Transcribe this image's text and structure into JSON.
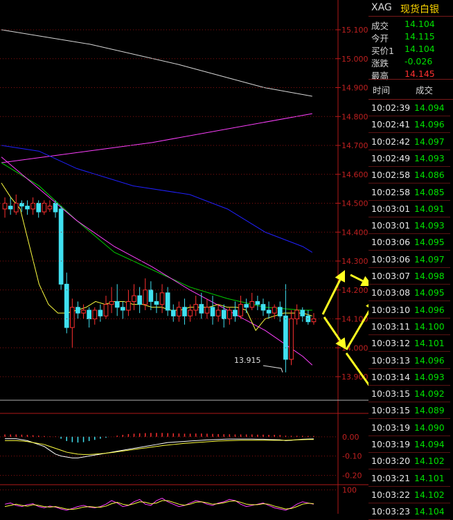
{
  "header": {
    "symbol": "XAG",
    "name": "现货白银"
  },
  "quote": [
    {
      "label": "成交",
      "value": "14.104",
      "color": "#00e000"
    },
    {
      "label": "今开",
      "value": "14.115",
      "color": "#00e000"
    },
    {
      "label": "买价1",
      "value": "14.104",
      "color": "#00e000"
    },
    {
      "label": "涨跌",
      "value": "-0.026",
      "color": "#00e000"
    },
    {
      "label": "最高",
      "value": "14.145",
      "color": "#ff3030"
    }
  ],
  "ticks_header": {
    "time": "时间",
    "price": "成交"
  },
  "ticks": [
    {
      "time": "10:02:39",
      "price": "14.094"
    },
    {
      "time": "10:02:41",
      "price": "14.096"
    },
    {
      "time": "10:02:42",
      "price": "14.097"
    },
    {
      "time": "10:02:49",
      "price": "14.093"
    },
    {
      "time": "10:02:58",
      "price": "14.086"
    },
    {
      "time": "10:02:58",
      "price": "14.085"
    },
    {
      "time": "10:03:01",
      "price": "14.091"
    },
    {
      "time": "10:03:01",
      "price": "14.093"
    },
    {
      "time": "10:03:06",
      "price": "14.095"
    },
    {
      "time": "10:03:06",
      "price": "14.097"
    },
    {
      "time": "10:03:07",
      "price": "14.098"
    },
    {
      "time": "10:03:08",
      "price": "14.095"
    },
    {
      "time": "10:03:10",
      "price": "14.096"
    },
    {
      "time": "10:03:11",
      "price": "14.100"
    },
    {
      "time": "10:03:12",
      "price": "14.101"
    },
    {
      "time": "10:03:13",
      "price": "14.096"
    },
    {
      "time": "10:03:14",
      "price": "14.093"
    },
    {
      "time": "10:03:15",
      "price": "14.092"
    },
    {
      "time": "10:03:15",
      "price": "14.089"
    },
    {
      "time": "10:03:19",
      "price": "14.090"
    },
    {
      "time": "10:03:19",
      "price": "14.094"
    },
    {
      "time": "10:03:20",
      "price": "14.102"
    },
    {
      "time": "10:03:21",
      "price": "14.101"
    },
    {
      "time": "10:03:22",
      "price": "14.102"
    },
    {
      "time": "10:03:23",
      "price": "14.104"
    }
  ],
  "chart_data": {
    "type": "candlestick",
    "main": {
      "y_ticks": [
        "15.100",
        "15.000",
        "14.900",
        "14.800",
        "14.700",
        "14.600",
        "14.500",
        "14.400",
        "14.300",
        "14.200",
        "14.100",
        "14.000",
        "13.900"
      ],
      "ylim": [
        13.85,
        15.12
      ],
      "low_annotation": {
        "label": "13.915",
        "value": 13.915
      },
      "candles": [
        [
          14.48,
          14.5,
          14.45,
          14.52
        ],
        [
          14.49,
          14.48,
          14.46,
          14.52
        ],
        [
          14.47,
          14.5,
          14.46,
          14.53
        ],
        [
          14.5,
          14.49,
          14.47,
          14.51
        ],
        [
          14.49,
          14.48,
          14.46,
          14.51
        ],
        [
          14.48,
          14.5,
          14.46,
          14.52
        ],
        [
          14.5,
          14.47,
          14.45,
          14.51
        ],
        [
          14.47,
          14.5,
          14.46,
          14.51
        ],
        [
          14.48,
          14.49,
          14.47,
          14.51
        ],
        [
          14.5,
          14.47,
          14.45,
          14.51
        ],
        [
          14.48,
          14.22,
          14.2,
          14.49
        ],
        [
          14.22,
          14.07,
          14.05,
          14.26
        ],
        [
          14.07,
          14.14,
          14.0,
          14.17
        ],
        [
          14.14,
          14.12,
          14.1,
          14.16
        ],
        [
          14.12,
          14.13,
          14.1,
          14.15
        ],
        [
          14.13,
          14.1,
          14.07,
          14.14
        ],
        [
          14.1,
          14.13,
          14.08,
          14.14
        ],
        [
          14.13,
          14.11,
          14.09,
          14.15
        ],
        [
          14.11,
          14.15,
          14.1,
          14.18
        ],
        [
          14.15,
          14.16,
          14.12,
          14.21
        ],
        [
          14.16,
          14.14,
          14.11,
          14.22
        ],
        [
          14.14,
          14.13,
          14.1,
          14.16
        ],
        [
          14.13,
          14.16,
          14.11,
          14.2
        ],
        [
          14.16,
          14.18,
          14.13,
          14.22
        ],
        [
          14.18,
          14.15,
          14.12,
          14.21
        ],
        [
          14.15,
          14.2,
          14.13,
          14.24
        ],
        [
          14.2,
          14.16,
          14.13,
          14.23
        ],
        [
          14.16,
          14.15,
          14.12,
          14.19
        ],
        [
          14.15,
          14.19,
          14.12,
          14.22
        ],
        [
          14.19,
          14.13,
          14.11,
          14.21
        ],
        [
          14.13,
          14.11,
          14.09,
          14.15
        ],
        [
          14.11,
          14.14,
          14.09,
          14.16
        ],
        [
          14.14,
          14.11,
          14.08,
          14.17
        ],
        [
          14.11,
          14.13,
          14.09,
          14.15
        ],
        [
          14.13,
          14.15,
          14.11,
          14.18
        ],
        [
          14.15,
          14.12,
          14.1,
          14.19
        ],
        [
          14.12,
          14.14,
          14.1,
          14.17
        ],
        [
          14.14,
          14.11,
          14.08,
          14.18
        ],
        [
          14.11,
          14.13,
          14.09,
          14.15
        ],
        [
          14.13,
          14.1,
          14.07,
          14.15
        ],
        [
          14.1,
          14.13,
          14.08,
          14.14
        ],
        [
          14.13,
          14.11,
          14.09,
          14.16
        ],
        [
          14.11,
          14.15,
          14.1,
          14.18
        ],
        [
          14.15,
          14.14,
          14.12,
          14.17
        ],
        [
          14.14,
          14.16,
          14.13,
          14.19
        ],
        [
          14.16,
          14.15,
          14.13,
          14.18
        ],
        [
          14.15,
          14.13,
          14.11,
          14.17
        ],
        [
          14.13,
          14.12,
          14.1,
          14.16
        ],
        [
          14.12,
          14.14,
          14.1,
          14.15
        ],
        [
          14.14,
          14.11,
          14.09,
          14.16
        ],
        [
          14.11,
          13.96,
          13.915,
          14.22
        ],
        [
          13.96,
          14.1,
          13.94,
          14.13
        ],
        [
          14.1,
          14.13,
          14.08,
          14.15
        ],
        [
          14.13,
          14.11,
          14.09,
          14.14
        ],
        [
          14.11,
          14.09,
          14.08,
          14.13
        ],
        [
          14.09,
          14.1,
          14.08,
          14.12
        ]
      ],
      "ma_lines": [
        {
          "color": "#d8d8d8",
          "points": [
            [
              0,
              15.1
            ],
            [
              94,
              15.05
            ],
            [
              188,
              14.98
            ],
            [
              279,
              14.9
            ],
            [
              330,
              14.87
            ]
          ]
        },
        {
          "color": "#ff40ff",
          "points": [
            [
              0,
              14.64
            ],
            [
              160,
              14.71
            ],
            [
              330,
              14.81
            ]
          ]
        },
        {
          "color": "#2020ff",
          "points": [
            [
              0,
              14.7
            ],
            [
              40,
              14.68
            ],
            [
              80,
              14.62
            ],
            [
              140,
              14.56
            ],
            [
              200,
              14.53
            ],
            [
              240,
              14.48
            ],
            [
              280,
              14.4
            ],
            [
              320,
              14.35
            ],
            [
              330,
              14.33
            ]
          ]
        },
        {
          "color": "#00d000",
          "points": [
            [
              0,
              14.64
            ],
            [
              40,
              14.56
            ],
            [
              80,
              14.44
            ],
            [
              120,
              14.33
            ],
            [
              160,
              14.27
            ],
            [
              200,
              14.21
            ],
            [
              240,
              14.17
            ],
            [
              280,
              14.14
            ],
            [
              320,
              14.13
            ],
            [
              330,
              14.13
            ]
          ]
        },
        {
          "color": "#ff40ff",
          "points": [
            [
              0,
              14.66
            ],
            [
              40,
              14.55
            ],
            [
              80,
              14.44
            ],
            [
              120,
              14.35
            ],
            [
              160,
              14.28
            ],
            [
              200,
              14.2
            ],
            [
              240,
              14.13
            ],
            [
              280,
              14.06
            ],
            [
              320,
              13.97
            ],
            [
              330,
              13.94
            ]
          ]
        },
        {
          "color": "#ffff40",
          "points": [
            [
              0,
              14.57
            ],
            [
              10,
              14.52
            ],
            [
              20,
              14.48
            ],
            [
              30,
              14.35
            ],
            [
              40,
              14.22
            ],
            [
              50,
              14.15
            ],
            [
              60,
              14.12
            ],
            [
              70,
              14.12
            ],
            [
              80,
              14.13
            ],
            [
              90,
              14.14
            ],
            [
              100,
              14.16
            ],
            [
              110,
              14.15
            ],
            [
              120,
              14.16
            ],
            [
              130,
              14.16
            ],
            [
              140,
              14.15
            ],
            [
              150,
              14.15
            ],
            [
              160,
              14.14
            ],
            [
              170,
              14.14
            ],
            [
              180,
              14.13
            ],
            [
              190,
              14.13
            ],
            [
              200,
              14.14
            ],
            [
              210,
              14.14
            ],
            [
              220,
              14.14
            ],
            [
              230,
              14.15
            ],
            [
              240,
              14.14
            ],
            [
              250,
              14.14
            ],
            [
              260,
              14.13
            ],
            [
              270,
              14.06
            ],
            [
              280,
              14.1
            ],
            [
              290,
              14.11
            ],
            [
              300,
              14.12
            ],
            [
              310,
              14.12
            ],
            [
              320,
              14.12
            ],
            [
              330,
              14.11
            ]
          ]
        }
      ]
    },
    "macd": {
      "y_ticks": [
        "0.00",
        "-0.10",
        "-0.20"
      ],
      "ylim": [
        -0.22,
        0.1
      ],
      "hist": [
        0.012,
        0.012,
        0.012,
        0.011,
        0.01,
        0.008,
        0.006,
        0.004,
        0.002,
        0.002,
        -0.01,
        -0.022,
        -0.028,
        -0.03,
        -0.028,
        -0.022,
        -0.016,
        -0.01,
        -0.005,
        0.0,
        0.006,
        0.01,
        0.014,
        0.016,
        0.018,
        0.019,
        0.02,
        0.02,
        0.02,
        0.019,
        0.018,
        0.017,
        0.016,
        0.016,
        0.017,
        0.017,
        0.016,
        0.015,
        0.014,
        0.013,
        0.013,
        0.012,
        0.012,
        0.012,
        0.012,
        0.011,
        0.011,
        0.01,
        0.01,
        0.009,
        0.006,
        0.005,
        0.005,
        0.005,
        0.004,
        0.004
      ],
      "lines": [
        {
          "color": "#ffffff",
          "values": [
            -0.01,
            -0.01,
            -0.01,
            -0.015,
            -0.02,
            -0.03,
            -0.04,
            -0.05,
            -0.07,
            -0.09,
            -0.1,
            -0.105,
            -0.11,
            -0.11,
            -0.105,
            -0.1,
            -0.095,
            -0.09,
            -0.085,
            -0.08,
            -0.075,
            -0.07,
            -0.065,
            -0.06,
            -0.055,
            -0.05,
            -0.045,
            -0.04,
            -0.035,
            -0.03,
            -0.028,
            -0.026,
            -0.024,
            -0.022,
            -0.02,
            -0.018,
            -0.016,
            -0.015,
            -0.014,
            -0.013,
            -0.012,
            -0.012,
            -0.012,
            -0.012,
            -0.012,
            -0.013,
            -0.013,
            -0.014,
            -0.015,
            -0.016,
            -0.02,
            -0.018,
            -0.015,
            -0.013,
            -0.012,
            -0.011
          ]
        },
        {
          "color": "#ffff40",
          "values": [
            -0.02,
            -0.02,
            -0.02,
            -0.022,
            -0.025,
            -0.03,
            -0.035,
            -0.04,
            -0.05,
            -0.06,
            -0.07,
            -0.08,
            -0.085,
            -0.09,
            -0.092,
            -0.092,
            -0.09,
            -0.088,
            -0.085,
            -0.082,
            -0.078,
            -0.074,
            -0.07,
            -0.066,
            -0.062,
            -0.058,
            -0.054,
            -0.05,
            -0.046,
            -0.043,
            -0.04,
            -0.037,
            -0.034,
            -0.032,
            -0.03,
            -0.028,
            -0.026,
            -0.024,
            -0.022,
            -0.021,
            -0.02,
            -0.019,
            -0.018,
            -0.018,
            -0.018,
            -0.018,
            -0.018,
            -0.018,
            -0.018,
            -0.018,
            -0.018,
            -0.017,
            -0.016,
            -0.015,
            -0.014,
            -0.014
          ]
        }
      ]
    },
    "osc": {
      "y_ticks": [
        "100"
      ],
      "ylim": [
        0,
        110
      ],
      "lines": [
        {
          "color": "#ff40ff",
          "values": [
            40,
            45,
            35,
            30,
            38,
            42,
            30,
            25,
            32,
            28,
            20,
            15,
            22,
            30,
            35,
            28,
            25,
            30,
            40,
            55,
            45,
            30,
            35,
            50,
            60,
            40,
            35,
            55,
            65,
            50,
            40,
            30,
            35,
            45,
            55,
            50,
            40,
            35,
            45,
            50,
            60,
            55,
            40,
            30,
            35,
            40,
            45,
            35,
            25,
            20,
            15,
            25,
            40,
            50,
            45,
            40
          ]
        },
        {
          "color": "#ffff40",
          "values": [
            30,
            35,
            40,
            35,
            32,
            38,
            35,
            30,
            28,
            30,
            25,
            20,
            18,
            22,
            28,
            30,
            28,
            27,
            32,
            42,
            48,
            40,
            36,
            42,
            50,
            48,
            42,
            45,
            55,
            55,
            48,
            40,
            36,
            40,
            48,
            50,
            46,
            40,
            42,
            46,
            52,
            54,
            48,
            40,
            38,
            38,
            42,
            40,
            32,
            26,
            20,
            22,
            30,
            40,
            44,
            42
          ]
        }
      ]
    }
  }
}
